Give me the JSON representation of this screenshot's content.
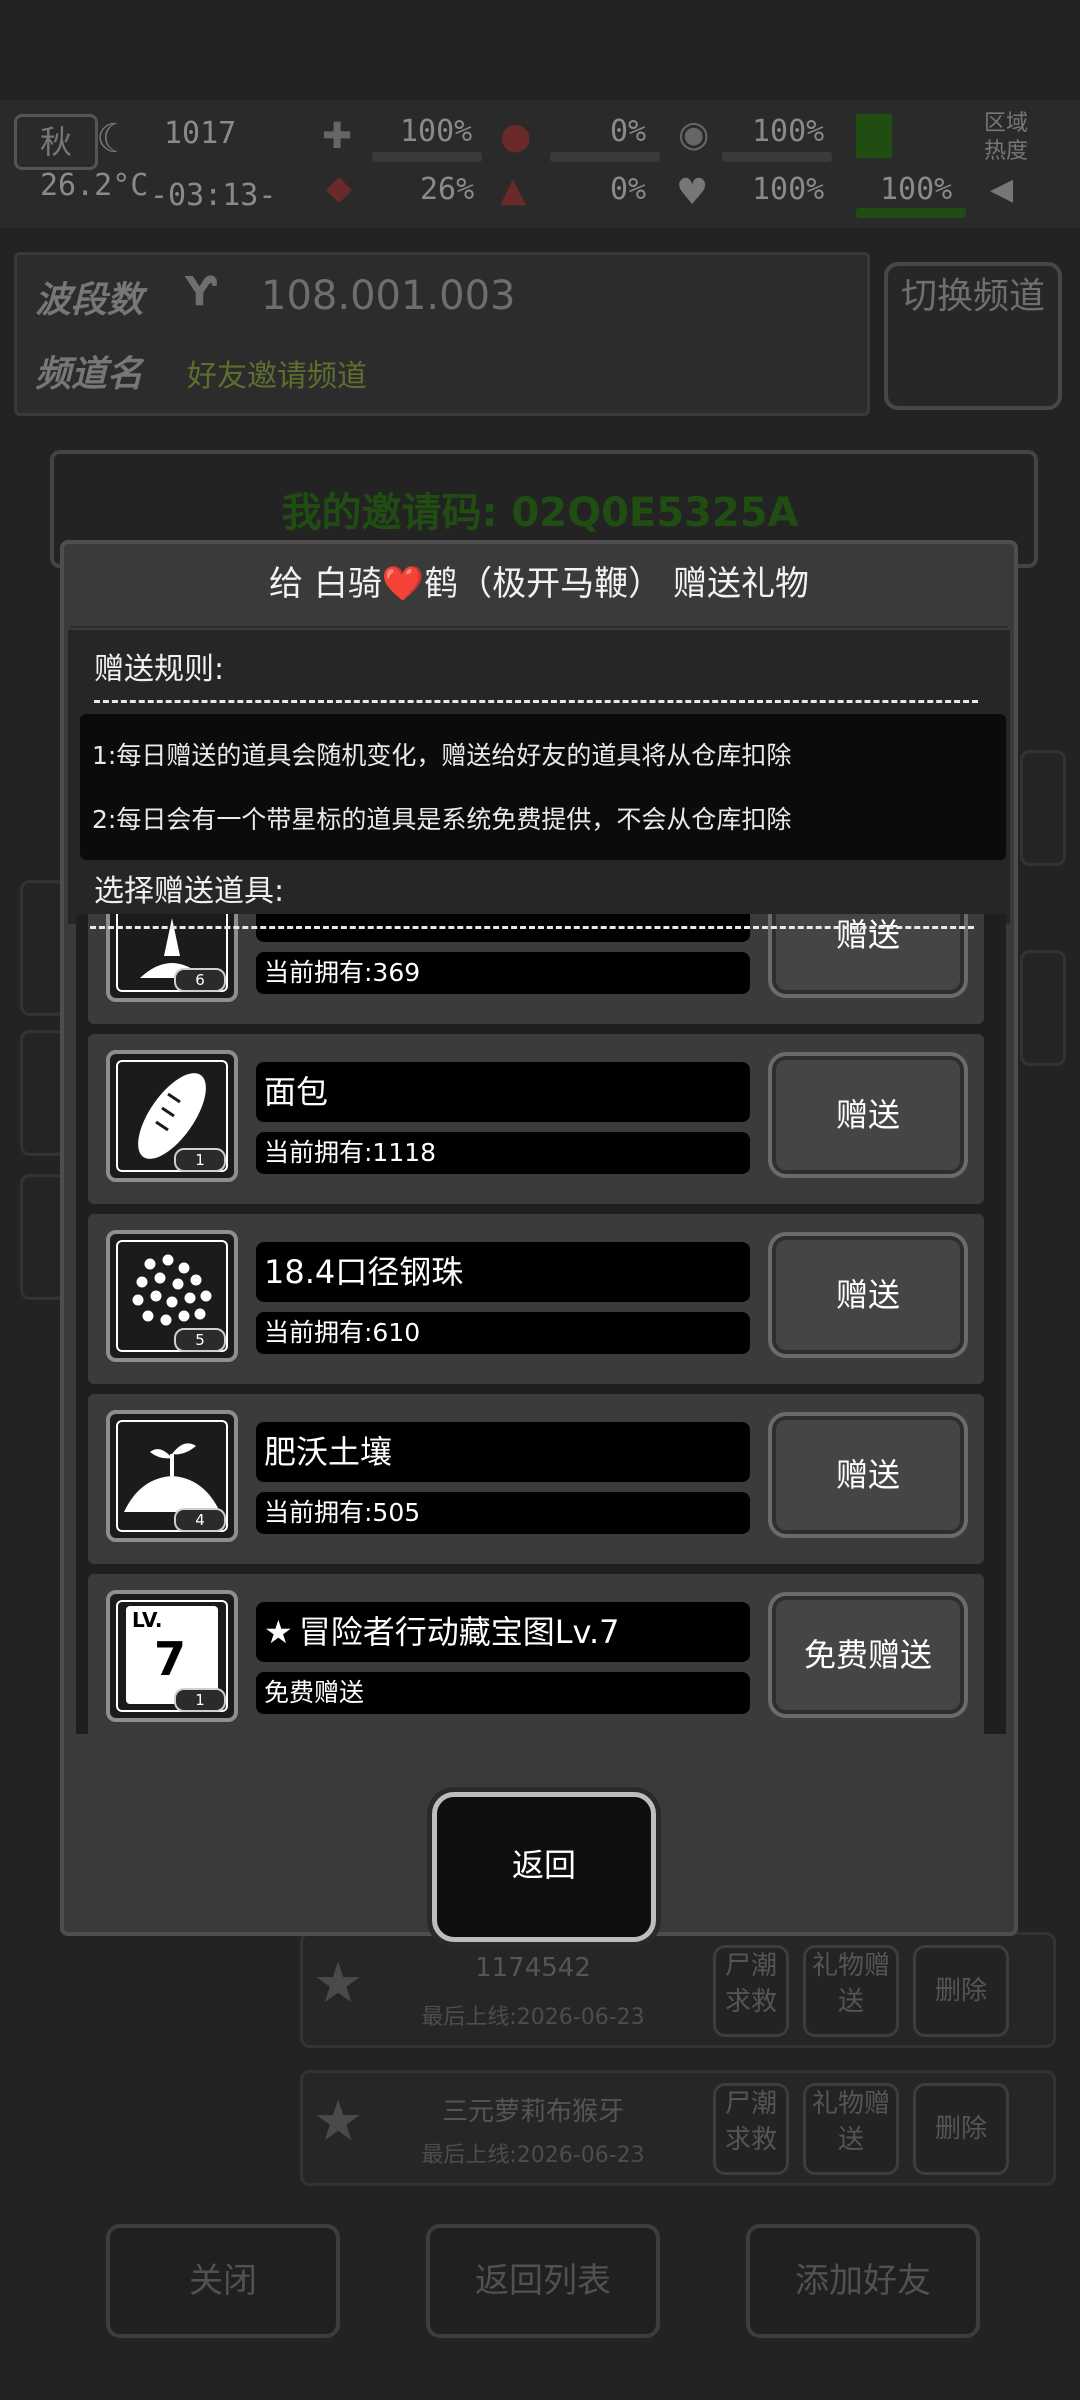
{
  "status": {
    "season": "秋",
    "time": "1017",
    "temperature": "26.2°C",
    "clock": "-03:13-",
    "stats_row1": [
      "100%",
      "0%",
      "100%"
    ],
    "stats_row2": [
      "26%",
      "0%",
      "100%",
      "100%"
    ],
    "region_heat": "区域热度"
  },
  "radio": {
    "band_label": "波段数",
    "band_value": "108.001.003",
    "channel_label": "频道名",
    "channel_value": "好友邀请频道",
    "switch_label": "切换频道",
    "invite_code": "我的邀请码: 02Q0E5325A"
  },
  "friends": [
    {
      "name": "1174542",
      "last_login": "最后上线:2026-06-23"
    },
    {
      "name": "三元萝莉布猴牙",
      "last_login": "最后上线:2026-06-23"
    }
  ],
  "friend_buttons": {
    "help": "尸潮求救",
    "gift": "礼物赠送",
    "delete": "删除"
  },
  "bottom_buttons": {
    "close": "关闭",
    "back_to_list": "返回列表",
    "add_friend": "添加好友"
  },
  "dialog": {
    "title": "给 白骑❤️鹤（极开马鞭） 赠送礼物",
    "rules_label": "赠送规则:",
    "rules": [
      "1:每日赠送的道具会随机变化，赠送给好友的道具将从仓库扣除",
      "2:每日会有一个带星标的道具是系统免费提供，不会从仓库扣除"
    ],
    "select_label": "选择赠送道具:",
    "items": [
      {
        "name": "",
        "owned": "当前拥有:369",
        "qty": "6",
        "button": "赠送",
        "icon": "water-drop-icon"
      },
      {
        "name": "面包",
        "owned": "当前拥有:1118",
        "qty": "1",
        "button": "赠送",
        "icon": "bread-icon"
      },
      {
        "name": "18.4口径钢珠",
        "owned": "当前拥有:610",
        "qty": "5",
        "button": "赠送",
        "icon": "steel-balls-icon"
      },
      {
        "name": "肥沃土壤",
        "owned": "当前拥有:505",
        "qty": "4",
        "button": "赠送",
        "icon": "soil-sprout-icon"
      },
      {
        "name": "冒险者行动藏宝图Lv.7",
        "owned": "免费赠送",
        "qty": "1",
        "button": "免费赠送",
        "icon": "treasure-map-icon",
        "starred": true,
        "lv_text": "LV.",
        "lv_num": "7"
      }
    ],
    "return_label": "返回"
  }
}
